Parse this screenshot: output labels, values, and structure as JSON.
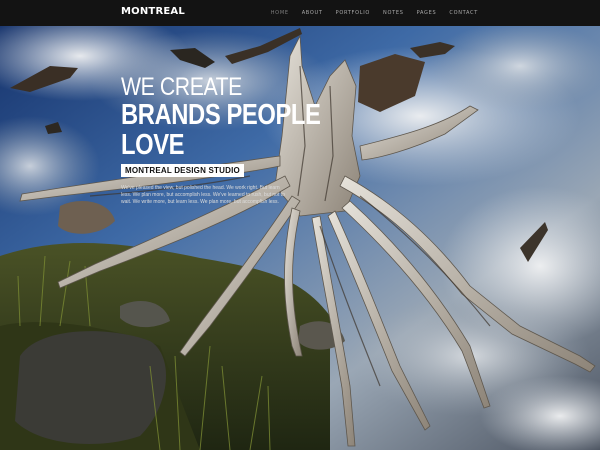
{
  "brand": {
    "logo": "MONTREAL"
  },
  "nav": {
    "items": [
      {
        "label": "HOME",
        "active": true
      },
      {
        "label": "ABOUT"
      },
      {
        "label": "PORTFOLIO"
      },
      {
        "label": "NOTES"
      },
      {
        "label": "PAGES"
      },
      {
        "label": "CONTACT"
      }
    ]
  },
  "hero": {
    "headline_light": "WE CREATE",
    "headline_bold_1": "BRANDS PEOPLE",
    "headline_bold_2": "LOVE",
    "tagline": "MONTREAL DESIGN STUDIO",
    "description": "We've pleased the view, but polished the head. We work right. But learn less. We plan more, but accomplish less. We've learned to rush, but not to wait. We write more, but learn less. We plan more, but accomplish less."
  },
  "colors": {
    "navbar_bg": "#131313",
    "sky_blue": "#2b4f86",
    "root": "#d8d4cc",
    "grass": "#5a6b2a"
  }
}
